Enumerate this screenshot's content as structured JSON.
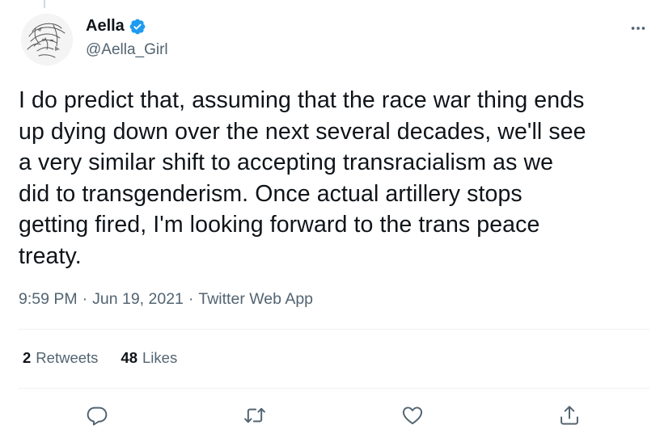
{
  "author": {
    "display_name": "Aella",
    "handle": "@Aella_Girl",
    "verified": true,
    "avatar_icon": "sketch-portrait-avatar"
  },
  "tweet": {
    "text": "I do predict that, assuming that the race war thing ends\nup dying down over the next several decades, we'll see\na very similar shift to accepting transracialism as we\ndid to transgenderism. Once actual artillery stops\ngetting fired, I'm looking forward to the trans peace\ntreaty.",
    "time": "9:59 PM",
    "date": "Jun 19, 2021",
    "source": "Twitter Web App",
    "separator": "·"
  },
  "stats": {
    "retweets_count": "2",
    "retweets_label": "Retweets",
    "likes_count": "48",
    "likes_label": "Likes"
  },
  "actions": [
    {
      "name": "reply",
      "icon": "reply-icon"
    },
    {
      "name": "retweet",
      "icon": "retweet-icon"
    },
    {
      "name": "like",
      "icon": "heart-icon"
    },
    {
      "name": "share",
      "icon": "share-icon"
    }
  ],
  "colors": {
    "verified": "#1d9bf0",
    "icon": "#536471",
    "text": "#0f1419",
    "secondary_text": "#536471",
    "divider": "#eff3f4"
  }
}
